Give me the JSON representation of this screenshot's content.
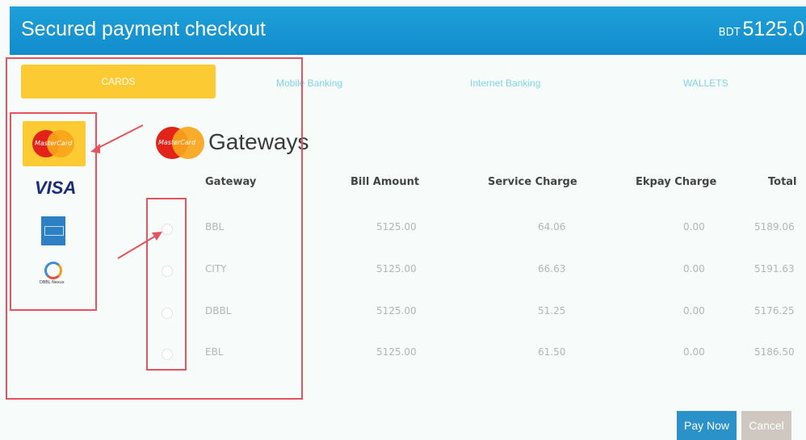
{
  "header": {
    "title": "Secured payment checkout",
    "currency": "BDT",
    "amount": "5125.0"
  },
  "tabs": [
    {
      "label": "CARDS",
      "active": true
    },
    {
      "label": "Mobile Banking",
      "active": false
    },
    {
      "label": "Internet Banking",
      "active": false
    },
    {
      "label": "WALLETS",
      "active": false
    }
  ],
  "card_brands": {
    "mastercard": "MasterCard",
    "visa": "VISA",
    "dbbl": "DBBL Nexus"
  },
  "gateways": {
    "title": "Gateways",
    "columns": [
      "Gateway",
      "Bill Amount",
      "Service Charge",
      "Ekpay Charge",
      "Total"
    ],
    "rows": [
      {
        "gateway": "BBL",
        "bill": "5125.00",
        "service": "64.06",
        "ekpay": "0.00",
        "total": "5189.06"
      },
      {
        "gateway": "CITY",
        "bill": "5125.00",
        "service": "66.63",
        "ekpay": "0.00",
        "total": "5191.63"
      },
      {
        "gateway": "DBBL",
        "bill": "5125.00",
        "service": "51.25",
        "ekpay": "0.00",
        "total": "5176.25"
      },
      {
        "gateway": "EBL",
        "bill": "5125.00",
        "service": "61.50",
        "ekpay": "0.00",
        "total": "5186.50"
      }
    ]
  },
  "actions": {
    "pay": "Pay Now",
    "cancel": "Cancel"
  },
  "colors": {
    "header": "#1a98d5",
    "accent": "#fccb33",
    "pay_button": "#2a91c9",
    "annotation": "#e4535e"
  }
}
